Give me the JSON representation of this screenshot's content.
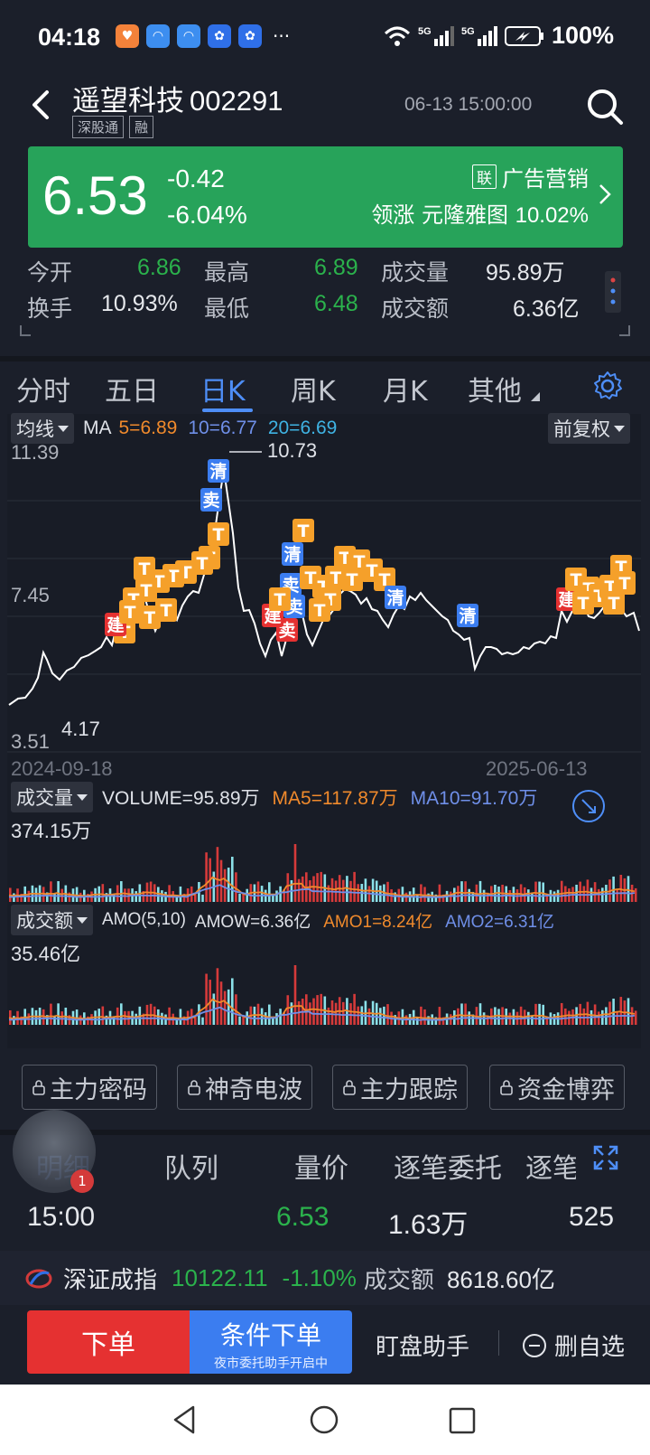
{
  "status_bar": {
    "time": "04:18",
    "battery": "100%",
    "signal_1": "5G",
    "signal_2": "5G"
  },
  "header": {
    "stock_name": "遥望科技",
    "stock_code": "002291",
    "tags": [
      "深股通",
      "融"
    ],
    "datetime": "06-13 15:00:00"
  },
  "quote": {
    "price": "6.53",
    "change": "-0.42",
    "change_pct": "-6.04%",
    "sector_tag": "联",
    "sector": "广告营销",
    "leader_label": "领涨",
    "leader_name": "元隆雅图",
    "leader_pct": "10.02%",
    "bg_color": "#27a35a"
  },
  "stats": {
    "open_label": "今开",
    "open": "6.86",
    "high_label": "最高",
    "high": "6.89",
    "volume_label": "成交量",
    "volume": "95.89万",
    "turnover_label": "换手",
    "turnover": "10.93%",
    "low_label": "最低",
    "low": "6.48",
    "amount_label": "成交额",
    "amount": "6.36亿"
  },
  "tabs": [
    "分时",
    "五日",
    "日K",
    "周K",
    "月K",
    "其他"
  ],
  "active_tab": "日K",
  "kline": {
    "indicator_dd": "均线",
    "ma_label": "MA",
    "ma5": "5=6.89",
    "ma10": "10=6.77",
    "ma20": "20=6.69",
    "adjust_dd": "前复权",
    "y_max": "11.39",
    "y_mid": "7.45",
    "y_min": "3.51",
    "peak_label": "10.73",
    "trough_label": "4.17",
    "date_start": "2024-09-18",
    "date_end": "2025-06-13",
    "marker_clear": "清",
    "marker_sell": "卖",
    "marker_t": "T",
    "marker_build": "建"
  },
  "volume_panel": {
    "dd": "成交量",
    "volume": "VOLUME=95.89万",
    "ma5": "MA5=117.87万",
    "ma10": "MA10=91.70万",
    "y_max": "374.15万"
  },
  "amount_panel": {
    "dd": "成交额",
    "amo": "AMO(5,10)",
    "amow": "AMOW=6.36亿",
    "amo1": "AMO1=8.24亿",
    "amo2": "AMO2=6.31亿",
    "y_max": "35.46亿"
  },
  "function_buttons": [
    "主力密码",
    "神奇电波",
    "主力跟踪",
    "资金博弈"
  ],
  "detail_tabs": [
    "明细",
    "队列",
    "量价",
    "逐笔委托",
    "逐笔"
  ],
  "avatar_badge": "1",
  "trade": {
    "time": "15:00",
    "price": "6.53",
    "volume": "1.63万",
    "count": "525"
  },
  "index": {
    "name": "深证成指",
    "value": "10122.11",
    "pct": "-1.10%",
    "amount_label": "成交额",
    "amount": "8618.60亿"
  },
  "actions": {
    "order": "下单",
    "cond_order": "条件下单",
    "cond_sub": "夜市委托助手开启中",
    "assistant": "盯盘助手",
    "remove": "删自选"
  },
  "colors": {
    "background": "#1b1f2a",
    "up_red": "#e53131",
    "down_green": "#2bb24c",
    "accent_blue": "#4e8ef7",
    "ma5_orange": "#f08a2c",
    "ma10_blue": "#6f8fe8",
    "ma20_cyan": "#3fb3e3"
  }
}
